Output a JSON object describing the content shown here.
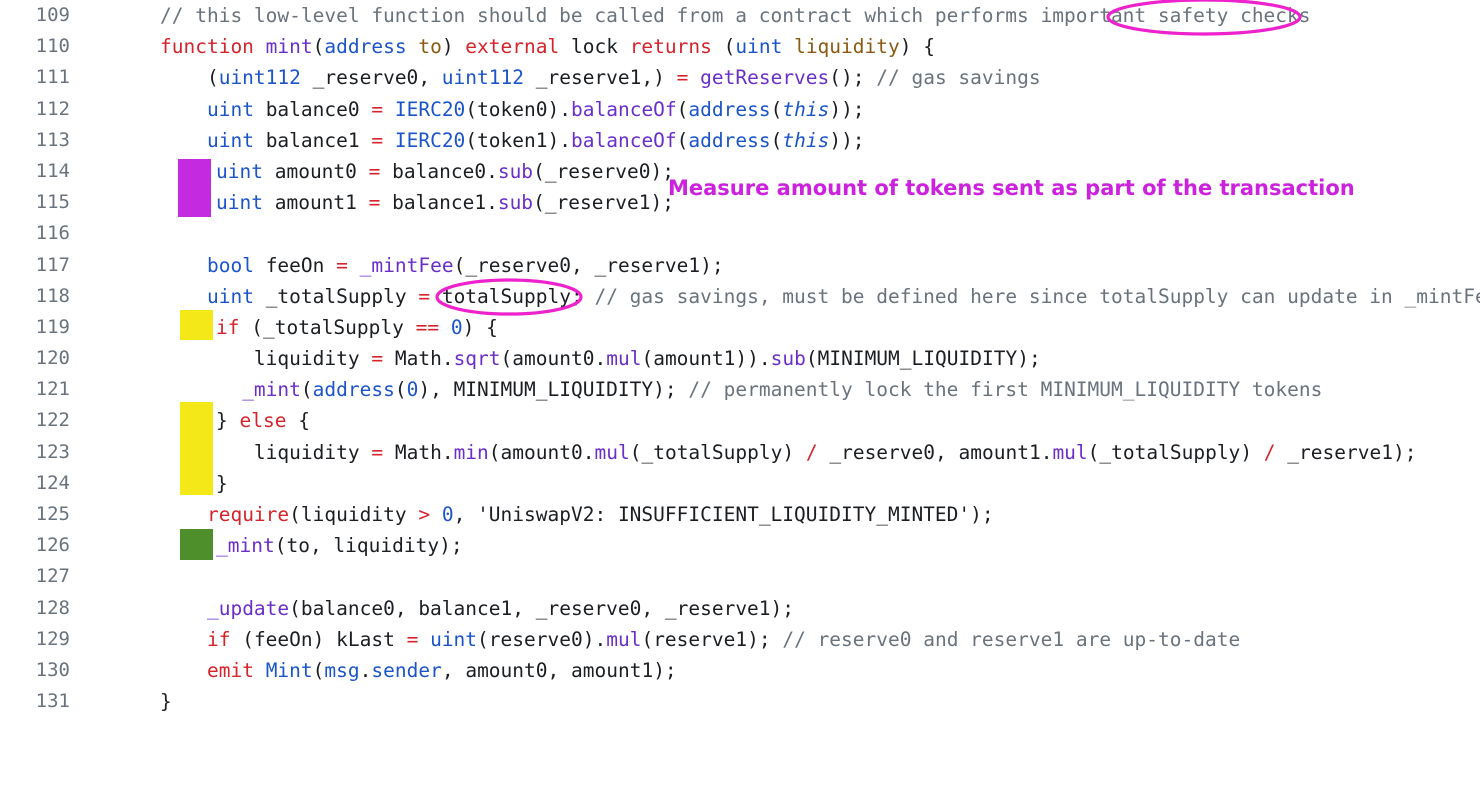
{
  "editor": {
    "language": "solidity",
    "background_color": "#ffffff",
    "line_number_color": "#6a737d",
    "first_line": 109,
    "last_line": 131
  },
  "lines": [
    {
      "number": "109",
      "text": "        // this low-level function should be called from a contract which performs important safety checks"
    },
    {
      "number": "110",
      "text": "        function mint(address to) external lock returns (uint liquidity) {"
    },
    {
      "number": "111",
      "text": "            (uint112 _reserve0, uint112 _reserve1,) = getReserves(); // gas savings"
    },
    {
      "number": "112",
      "text": "            uint balance0 = IERC20(token0).balanceOf(address(this));"
    },
    {
      "number": "113",
      "text": "            uint balance1 = IERC20(token1).balanceOf(address(this));"
    },
    {
      "number": "114",
      "text": "            uint amount0 = balance0.sub(_reserve0);"
    },
    {
      "number": "115",
      "text": "            uint amount1 = balance1.sub(_reserve1);"
    },
    {
      "number": "116",
      "text": ""
    },
    {
      "number": "117",
      "text": "            bool feeOn = _mintFee(_reserve0, _reserve1);"
    },
    {
      "number": "118",
      "text": "            uint _totalSupply = totalSupply; // gas savings, must be defined here since totalSupply can update in _mintFee"
    },
    {
      "number": "119",
      "text": "            if (_totalSupply == 0) {"
    },
    {
      "number": "120",
      "text": "                liquidity = Math.sqrt(amount0.mul(amount1)).sub(MINIMUM_LIQUIDITY);"
    },
    {
      "number": "121",
      "text": "               _mint(address(0), MINIMUM_LIQUIDITY); // permanently lock the first MINIMUM_LIQUIDITY tokens"
    },
    {
      "number": "122",
      "text": "            } else {"
    },
    {
      "number": "123",
      "text": "                liquidity = Math.min(amount0.mul(_totalSupply) / _reserve0, amount1.mul(_totalSupply) / _reserve1);"
    },
    {
      "number": "124",
      "text": "            }"
    },
    {
      "number": "125",
      "text": "            require(liquidity > 0, 'UniswapV2: INSUFFICIENT_LIQUIDITY_MINTED');"
    },
    {
      "number": "126",
      "text": "            _mint(to, liquidity);"
    },
    {
      "number": "127",
      "text": ""
    },
    {
      "number": "128",
      "text": "            _update(balance0, balance1, _reserve0, _reserve1);"
    },
    {
      "number": "129",
      "text": "            if (feeOn) kLast = uint(reserve0).mul(reserve1); // reserve0 and reserve1 are up-to-date"
    },
    {
      "number": "130",
      "text": "            emit Mint(msg.sender, amount0, amount1);"
    },
    {
      "number": "131",
      "text": "        }"
    }
  ],
  "highlights": [
    {
      "id": "purple-block",
      "color": "#c42ae0",
      "lines": "114-115",
      "label": "purple marker block"
    },
    {
      "id": "yellow-block-1",
      "color": "#f4e818",
      "lines": "119",
      "label": "yellow marker block"
    },
    {
      "id": "yellow-block-2",
      "color": "#f4e818",
      "lines": "122-124",
      "label": "yellow marker block"
    },
    {
      "id": "green-block",
      "color": "#4f8f2b",
      "lines": "126",
      "label": "green marker block"
    }
  ],
  "annotations": {
    "color": "#cc22dd",
    "ellipse_color": "#ee22cc",
    "notes": [
      {
        "id": "measure-note",
        "text": "Measure amount of tokens sent as part of the transaction"
      }
    ],
    "ellipses": [
      {
        "id": "safety-checks-ellipse",
        "target": "safety checks"
      },
      {
        "id": "total-supply-ellipse",
        "target": "totalSupply;"
      }
    ]
  }
}
